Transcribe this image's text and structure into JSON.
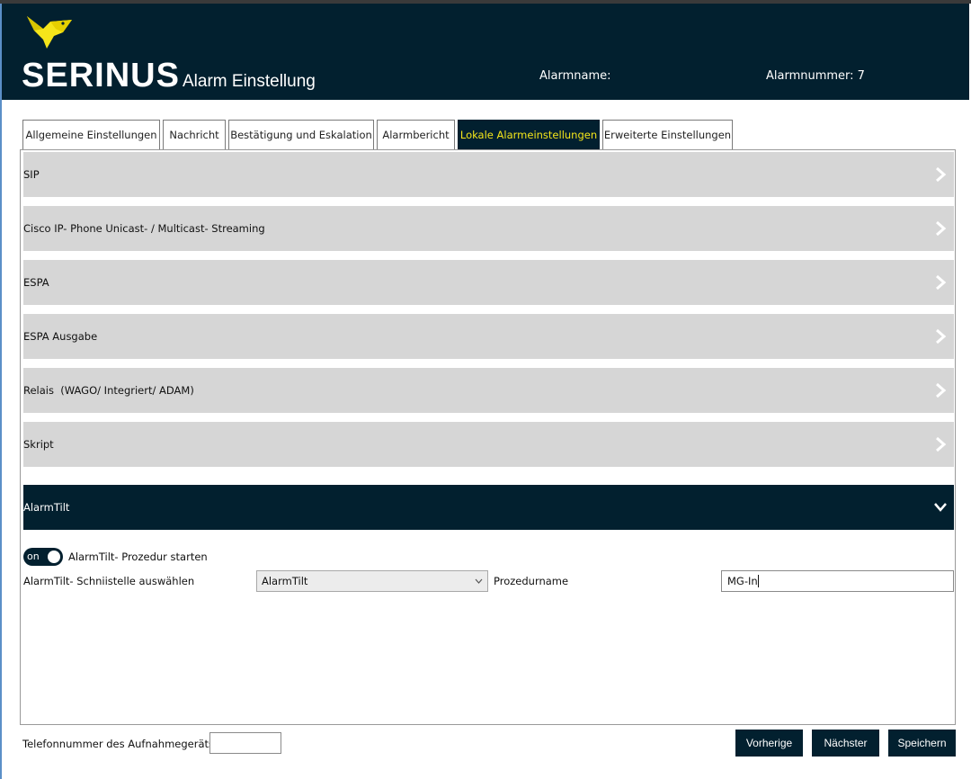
{
  "header": {
    "brand": "SERINUS",
    "subtitle": "Alarm Einstellung",
    "alarm_name_label": "Alarmname:",
    "alarm_number_label": "Alarmnummer: 7"
  },
  "tabs": [
    {
      "label": "Allgemeine Einstellungen",
      "active": false
    },
    {
      "label": "Nachricht",
      "active": false
    },
    {
      "label": "Bestätigung und Eskalation",
      "active": false
    },
    {
      "label": "Alarmbericht",
      "active": false
    },
    {
      "label": "Lokale Alarmeinstellungen",
      "active": true
    },
    {
      "label": "Erweiterte Einstellungen",
      "active": false
    }
  ],
  "sections": [
    {
      "label": "SIP",
      "expanded": false
    },
    {
      "label": "Cisco IP- Phone Unicast- / Multicast- Streaming",
      "expanded": false
    },
    {
      "label": "ESPA",
      "expanded": false
    },
    {
      "label": "ESPA Ausgabe",
      "expanded": false
    },
    {
      "label": "Relais  (WAGO/ Integriert/ ADAM)",
      "expanded": false
    },
    {
      "label": "Skript",
      "expanded": false
    },
    {
      "label": "AlarmTilt",
      "expanded": true
    }
  ],
  "alarmtilt": {
    "toggle_state": "on",
    "toggle_label": "AlarmTilt- Prozedur starten",
    "interface_label": "AlarmTilt- Schniistelle auswählen",
    "interface_value": "AlarmTilt",
    "procedure_label": "Prozedurname",
    "procedure_value": "MG-In"
  },
  "footer": {
    "phone_label": "Telefonnummer des Aufnahmegeräts",
    "phone_value": "",
    "prev_label": "Vorherige",
    "next_label": "Nächster",
    "save_label": "Speichern"
  },
  "colors": {
    "navy": "#02202f",
    "accent_yellow": "#f5e51a",
    "section_gray": "#d6d6d6"
  },
  "icons": {
    "logo": "canary-bird-icon",
    "collapsed": "chevron-right-icon",
    "expanded": "chevron-down-icon",
    "dropdown": "chevron-down-small-icon"
  }
}
